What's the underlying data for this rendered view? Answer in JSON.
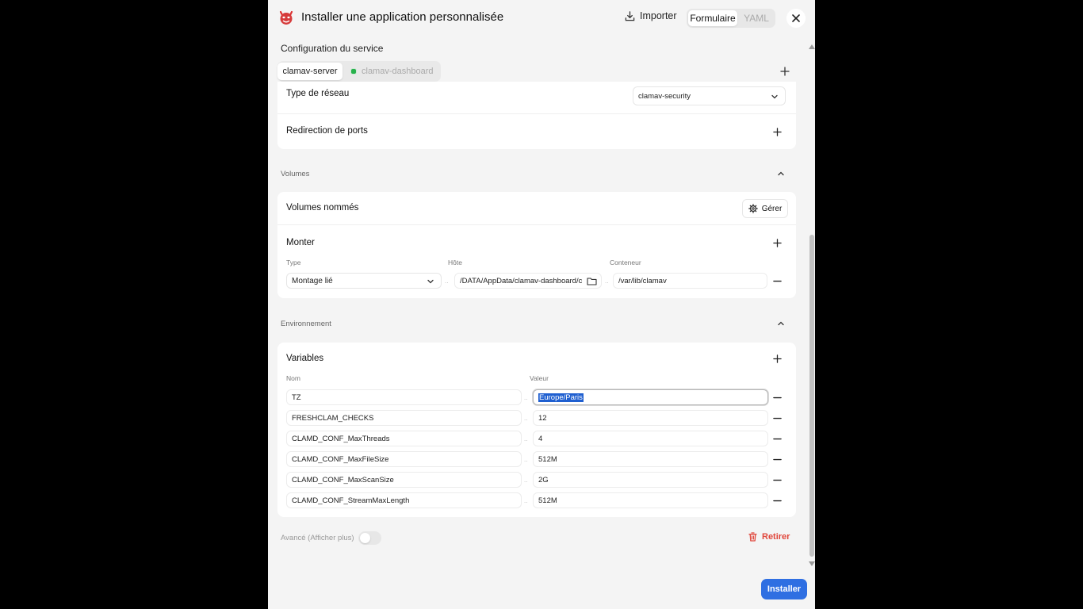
{
  "header": {
    "title": "Installer une application personnalisée",
    "import_label": "Importer",
    "mode_form": "Formulaire",
    "mode_yaml": "YAML"
  },
  "service_config": {
    "title": "Configuration du service",
    "tabs": [
      "clamav-server",
      "clamav-dashboard"
    ]
  },
  "network": {
    "type_label": "Type de réseau",
    "type_value": "clamav-security",
    "port_redirect_label": "Redirection de ports"
  },
  "volumes": {
    "section_title": "Volumes",
    "named_volumes_label": "Volumes nommés",
    "manage_label": "Gérer",
    "mount_label": "Monter",
    "col_type": "Type",
    "col_host": "Hôte",
    "col_container": "Conteneur",
    "mount_type": "Montage lié",
    "mount_host": "/DATA/AppData/clamav-dashboard/c",
    "mount_container": "/var/lib/clamav"
  },
  "environment": {
    "section_title": "Environnement",
    "variables_label": "Variables",
    "col_name": "Nom",
    "col_value": "Valeur",
    "vars": [
      {
        "name": "TZ",
        "value": "Europe/Paris"
      },
      {
        "name": "FRESHCLAM_CHECKS",
        "value": "12"
      },
      {
        "name": "CLAMD_CONF_MaxThreads",
        "value": "4"
      },
      {
        "name": "CLAMD_CONF_MaxFileSize",
        "value": "512M"
      },
      {
        "name": "CLAMD_CONF_MaxScanSize",
        "value": "2G"
      },
      {
        "name": "CLAMD_CONF_StreamMaxLength",
        "value": "512M"
      }
    ]
  },
  "footer": {
    "advanced_label": "Avancé (Afficher plus)",
    "remove_label": "Retirer",
    "install_label": "Installer"
  },
  "colors": {
    "accent": "#2f6fe2",
    "danger": "#e0463b",
    "active_dot": "#28b14c"
  }
}
